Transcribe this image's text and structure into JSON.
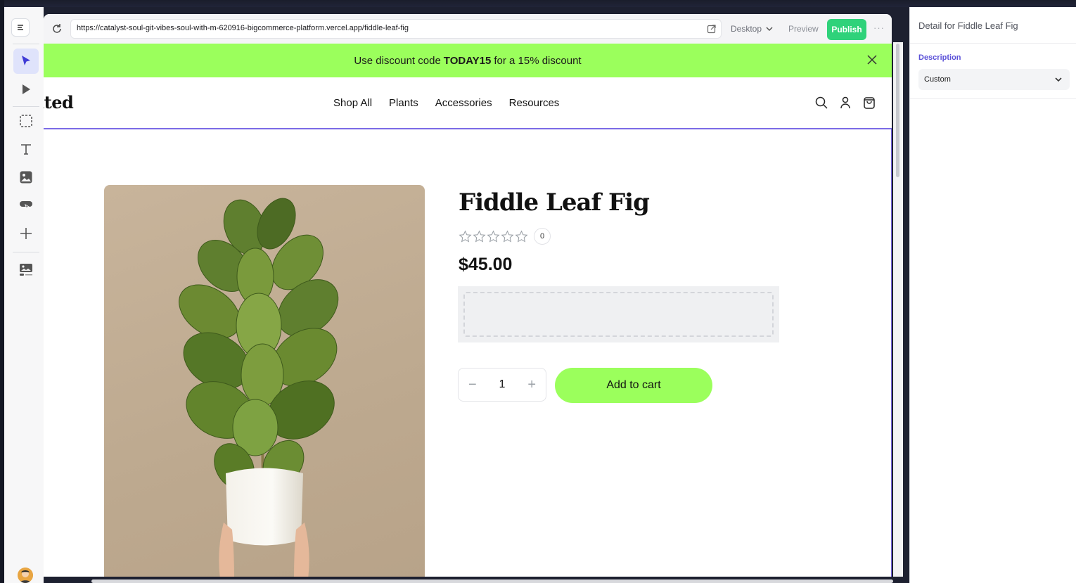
{
  "app": {
    "url": "https://catalyst-soul-git-vibes-soul-with-m-620916-bigcommerce-platform.vercel.app/fiddle-leaf-fig",
    "device": "Desktop",
    "preview_label": "Preview",
    "publish_label": "Publish",
    "more_label": "···"
  },
  "banner": {
    "prefix": "Use discount code",
    "code": "TODAY15",
    "suffix": "for a 15% discount"
  },
  "site": {
    "logo": "ited",
    "nav": [
      "Shop All",
      "Plants",
      "Accessories",
      "Resources"
    ]
  },
  "product": {
    "title": "Fiddle Leaf Fig",
    "rating_stars": 0,
    "review_count": "0",
    "price": "$45.00",
    "quantity": "1",
    "add_to_cart": "Add to cart"
  },
  "panel": {
    "title": "Detail for Fiddle Leaf Fig",
    "description_label": "Description",
    "description_value": "Custom"
  },
  "colors": {
    "accent_green": "#9bff5c",
    "publish_green": "#2fd27a",
    "selection_purple": "#7b6be6",
    "panel_label": "#5b51d8"
  }
}
